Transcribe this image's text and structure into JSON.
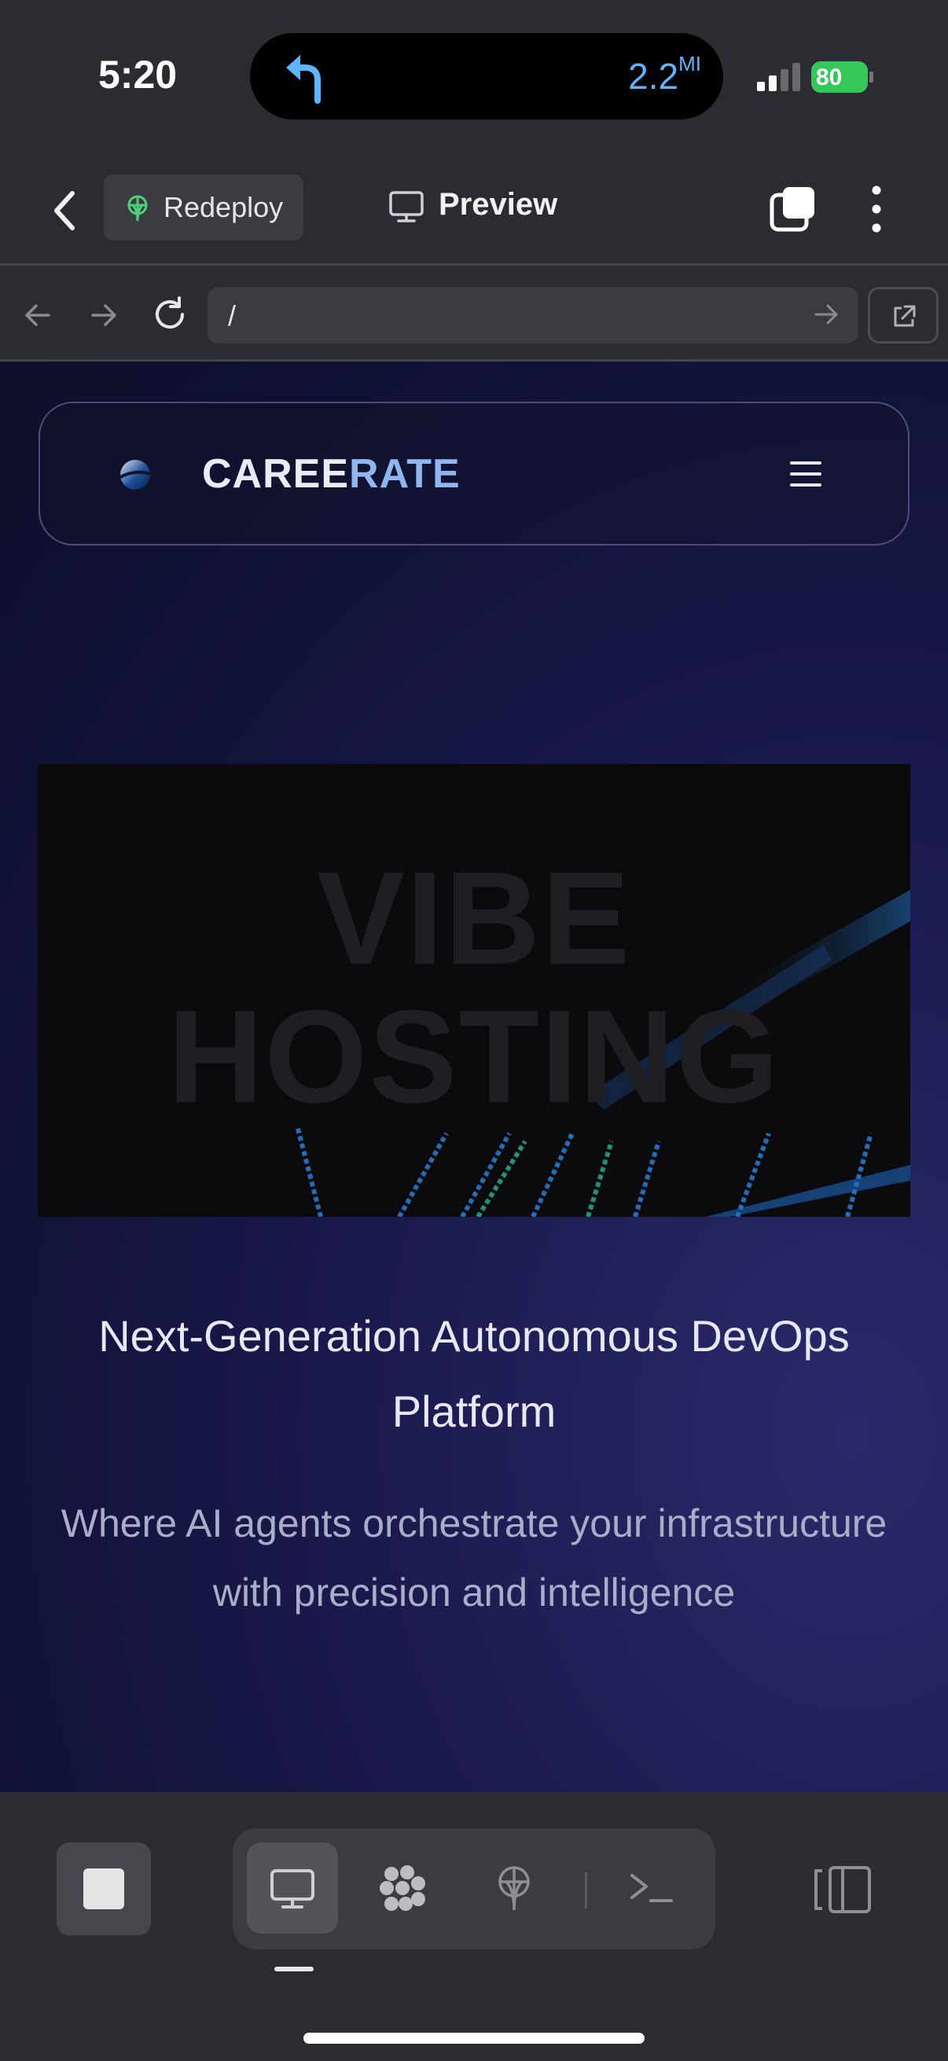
{
  "status_bar": {
    "time": "5:20",
    "nav_distance": "2.2",
    "nav_unit": "MI",
    "battery_level": "80",
    "battery_color": "#34c759",
    "signal_bars": 2
  },
  "app_header": {
    "back_icon": "chevron-left-icon",
    "redeploy_label": "Redeploy",
    "preview_label": "Preview",
    "tabs_icon": "tabs-icon",
    "more_icon": "more-vertical-icon"
  },
  "browser_bar": {
    "url": "/",
    "back_icon": "arrow-left-icon",
    "forward_icon": "arrow-right-icon",
    "reload_icon": "reload-icon",
    "open_external_icon": "external-link-icon"
  },
  "webpage": {
    "brand_part_a": "CAREE",
    "brand_part_b": "RATE",
    "hero_title_line1": "VIBE",
    "hero_title_line2": "HOSTING",
    "headline": "Next-Generation Autonomous DevOps Platform",
    "subline": "Where AI agents orchestrate your infrastructure with precision and intelligence",
    "accent_color": "#8fb6ee",
    "background_color": "#1b1a4e"
  },
  "bottom_bar": {
    "stop_icon": "stop-icon",
    "modes": [
      "monitor-icon",
      "agents-icon",
      "deploy-icon",
      "terminal-icon"
    ],
    "active_mode": "monitor-icon",
    "panel_icon": "side-panel-icon"
  }
}
